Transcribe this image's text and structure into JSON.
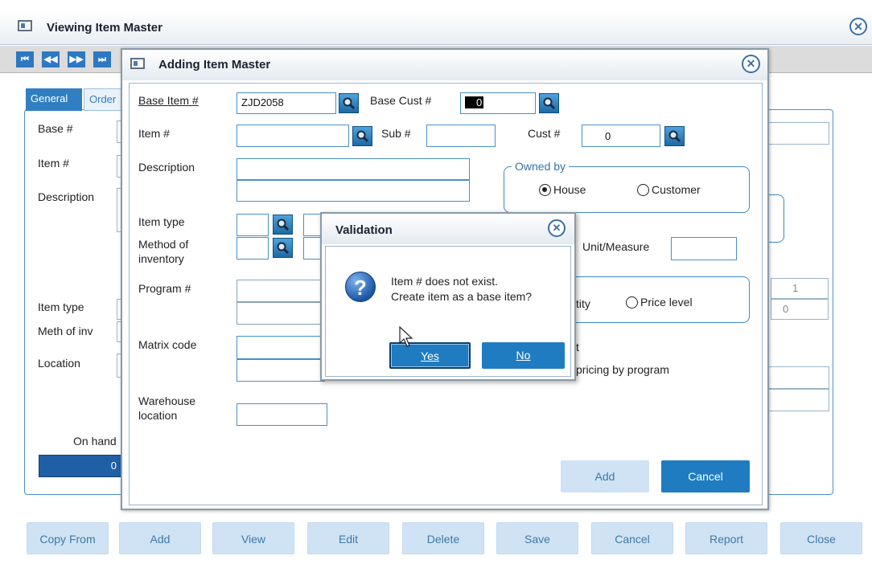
{
  "main_window": {
    "title": "Viewing Item Master",
    "tabs": [
      "General",
      "Order"
    ],
    "labels": {
      "base": "Base #",
      "item": "Item #",
      "description": "Description",
      "item_type": "Item type",
      "meth_inv": "Meth of inv",
      "location": "Location",
      "on_hand": "On hand"
    },
    "on_hand_value": "0",
    "right_fields": [
      "1",
      "0"
    ],
    "buttons": [
      "Copy From",
      "Add",
      "View",
      "Edit",
      "Delete",
      "Save",
      "Cancel",
      "Report",
      "Close"
    ]
  },
  "add_dialog": {
    "title": "Adding Item Master",
    "base_item_label": "Base Item #",
    "base_item_value": "ZJD2058",
    "base_cust_label": "Base Cust #",
    "base_cust_value": "0",
    "item_label": "Item #",
    "sub_label": "Sub #",
    "cust_label": "Cust #",
    "cust_value": "0",
    "description_label": "Description",
    "owned_by_label": "Owned by",
    "owned_house": "House",
    "owned_customer": "Customer",
    "item_type_label": "Item type",
    "method_label_1": "Method of",
    "method_label_2": "inventory",
    "unit_measure_label": "Unit/Measure",
    "program_label": "Program #",
    "quantity_partial": "tity",
    "price_level": "Price level",
    "matrix_label": "Matrix code",
    "set_partial": "t",
    "pricing_partial": "pricing by program",
    "warehouse_label_1": "Warehouse",
    "warehouse_label_2": "location",
    "add_button": "Add",
    "cancel_button": "Cancel"
  },
  "validation": {
    "title": "Validation",
    "message_line1": "Item # does not exist.",
    "message_line2": "Create item as a base item?",
    "yes": "Yes",
    "no": "No"
  }
}
